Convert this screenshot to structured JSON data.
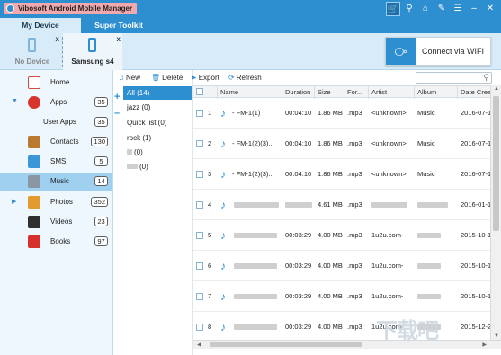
{
  "app": {
    "title": "Vibosoft Android Mobile Manager"
  },
  "titlebar_icons": [
    "cart-icon",
    "search-icon",
    "home-icon",
    "feedback-icon",
    "menu-icon",
    "minimize-icon",
    "close-icon"
  ],
  "tabs": [
    {
      "label": "My Device",
      "active": true
    },
    {
      "label": "Super Toolkit",
      "active": false
    }
  ],
  "devices": [
    {
      "label": "No Device",
      "close": "x"
    },
    {
      "label": "Samsung s4",
      "close": "x"
    }
  ],
  "wifi_button": {
    "label": "Connect via WIFI"
  },
  "sidebar": {
    "items": [
      {
        "label": "Home",
        "icon": "home-icon",
        "count": ""
      },
      {
        "label": "Apps",
        "icon": "apps-icon",
        "count": "35",
        "expanded": true
      },
      {
        "label": "User Apps",
        "icon": "",
        "count": "35",
        "sub": true
      },
      {
        "label": "Contacts",
        "icon": "contacts-icon",
        "count": "130"
      },
      {
        "label": "SMS",
        "icon": "sms-icon",
        "count": "5"
      },
      {
        "label": "Music",
        "icon": "music-icon",
        "count": "14",
        "active": true
      },
      {
        "label": "Photos",
        "icon": "photos-icon",
        "count": "352",
        "collapsed": true
      },
      {
        "label": "Videos",
        "icon": "videos-icon",
        "count": "23"
      },
      {
        "label": "Books",
        "icon": "books-icon",
        "count": "97"
      }
    ]
  },
  "playlists": {
    "items": [
      {
        "label": "All (14)",
        "active": true
      },
      {
        "label": "jazz (0)"
      },
      {
        "label": "Quick list (0)"
      },
      {
        "label": "rock (1)"
      },
      {
        "label": "(0)"
      },
      {
        "label": "(0)"
      }
    ]
  },
  "toolbar": {
    "new_label": "New",
    "delete_label": "Delete",
    "export_label": "Export",
    "refresh_label": "Refresh"
  },
  "table": {
    "columns": [
      "",
      "Name",
      "Duration",
      "Size",
      "For...",
      "Artist",
      "Album",
      "Date Crea"
    ],
    "rows": [
      {
        "num": "1",
        "name": "-   FM-1(1)",
        "duration": "00:04:10",
        "size": "1.86 MB",
        "format": ".mp3",
        "artist": "<unknown>",
        "album": "Music",
        "date": "2016-07-1"
      },
      {
        "num": "2",
        "name": "-   FM-1(2)(3)...",
        "duration": "00:04:10",
        "size": "1.86 MB",
        "format": ".mp3",
        "artist": "<unknown>",
        "album": "Music",
        "date": "2016-07-1"
      },
      {
        "num": "3",
        "name": "-   FM-1(2)(3)...",
        "duration": "00:04:10",
        "size": "1.86 MB",
        "format": ".mp3",
        "artist": "<unknown>",
        "album": "Music",
        "date": "2016-07-1"
      },
      {
        "num": "4",
        "name": "",
        "duration": "",
        "size": "4.61 MB",
        "format": ".mp3",
        "artist": "",
        "album": "",
        "date": "2016-01-1"
      },
      {
        "num": "5",
        "name": "",
        "duration": "00:03:29",
        "size": "4.00 MB",
        "format": ".mp3",
        "artist": "1u2u.com-",
        "album": "",
        "date": "2015-10-1"
      },
      {
        "num": "6",
        "name": "",
        "duration": "00:03:29",
        "size": "4.00 MB",
        "format": ".mp3",
        "artist": "1u2u.com-",
        "album": "",
        "date": "2015-10-1"
      },
      {
        "num": "7",
        "name": "",
        "duration": "00:03:29",
        "size": "4.00 MB",
        "format": ".mp3",
        "artist": "1u2u.com-",
        "album": "",
        "date": "2015-10-1"
      },
      {
        "num": "8",
        "name": "",
        "duration": "00:03:29",
        "size": "4.00 MB",
        "format": ".mp3",
        "artist": "1u2u.com-",
        "album": "",
        "date": "2015-12-2"
      }
    ]
  },
  "colors": {
    "accent": "#2e8fd0",
    "title_badge": "#f1a9ad",
    "sidebar_active": "#9fd0f0"
  }
}
